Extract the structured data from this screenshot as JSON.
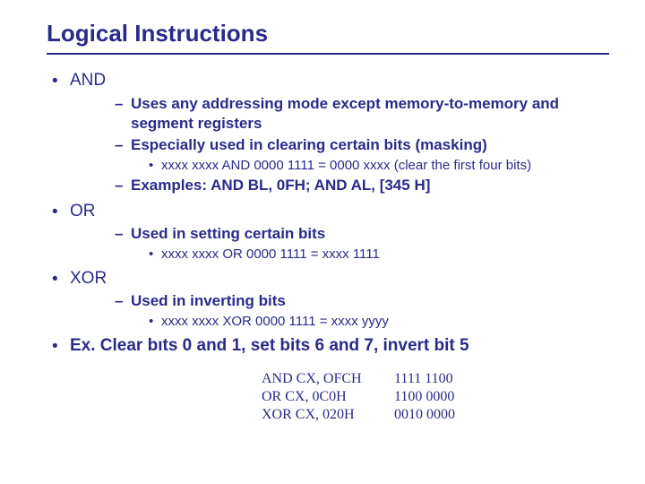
{
  "title": "Logical Instructions",
  "items": {
    "and": {
      "label": "AND",
      "sub1": "Uses any addressing mode except memory-to-memory and segment registers",
      "sub2": "Especially used in clearing certain bits (masking)",
      "sub2a": "xxxx xxxx  AND 0000 1111 = 0000 xxxx (clear the first four bits)",
      "sub3": "Examples: AND BL, 0FH;  AND AL, [345 H]"
    },
    "or": {
      "label": "OR",
      "sub1": "Used in setting certain bits",
      "sub1a": "xxxx xxxx OR 0000 1111  = xxxx 1111"
    },
    "xor": {
      "label": "XOR",
      "sub1": "Used in inverting bits",
      "sub1a": "xxxx xxxx XOR 0000 1111 = xxxx yyyy"
    },
    "ex": {
      "label": "Ex. Clear bıts 0 and 1, set bits 6 and 7, invert bit 5",
      "rows": [
        {
          "c1": "AND CX, OFCH",
          "c2": "1111 1100"
        },
        {
          "c1": "OR CX, 0C0H",
          "c2": "1100 0000"
        },
        {
          "c1": "XOR CX, 020H",
          "c2": "0010 0000"
        }
      ]
    }
  }
}
